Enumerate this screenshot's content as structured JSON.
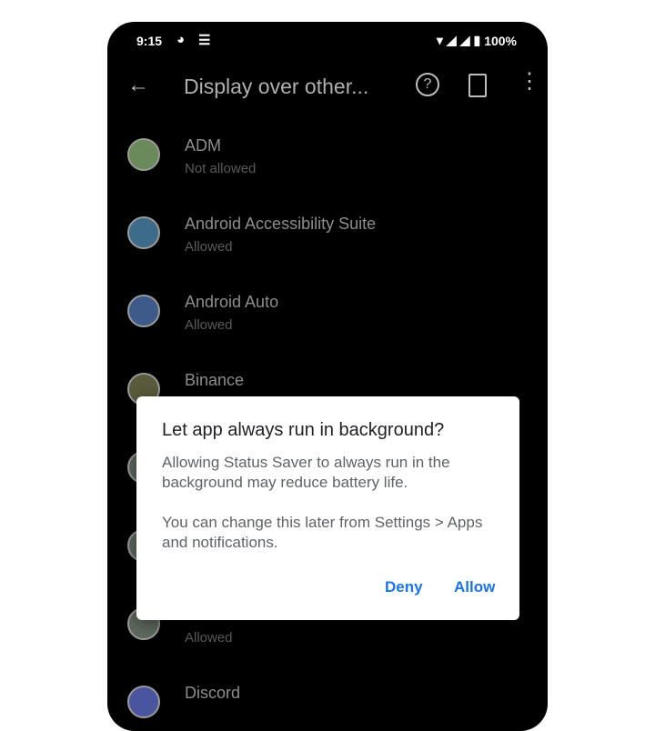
{
  "status_bar": {
    "time": "9:15",
    "battery": "100%"
  },
  "app_bar": {
    "title": "Display over other..."
  },
  "apps": [
    {
      "name": "ADM",
      "status": "Not allowed",
      "icon": "adm-icon"
    },
    {
      "name": "Android Accessibility Suite",
      "status": "Allowed",
      "icon": "accessibility-suite-icon"
    },
    {
      "name": "Android Auto",
      "status": "Allowed",
      "icon": "android-auto-icon"
    },
    {
      "name": "Binance",
      "status": "",
      "icon": "binance-icon"
    },
    {
      "name": "",
      "status": "",
      "icon": "app-icon"
    },
    {
      "name": "",
      "status": "",
      "icon": "app-icon"
    },
    {
      "name": "",
      "status": "Allowed",
      "icon": "app-icon"
    },
    {
      "name": "Discord",
      "status": "",
      "icon": "discord-icon"
    }
  ],
  "dialog": {
    "title": "Let app always run in background?",
    "body_1": "Allowing Status Saver to always run in the background may reduce battery life.",
    "body_2": "You can change this later from Settings > Apps and notifications.",
    "deny_label": "Deny",
    "allow_label": "Allow"
  },
  "colors": {
    "accent": "#1a73e8",
    "background": "#000000",
    "dialog": "#ffffff"
  }
}
